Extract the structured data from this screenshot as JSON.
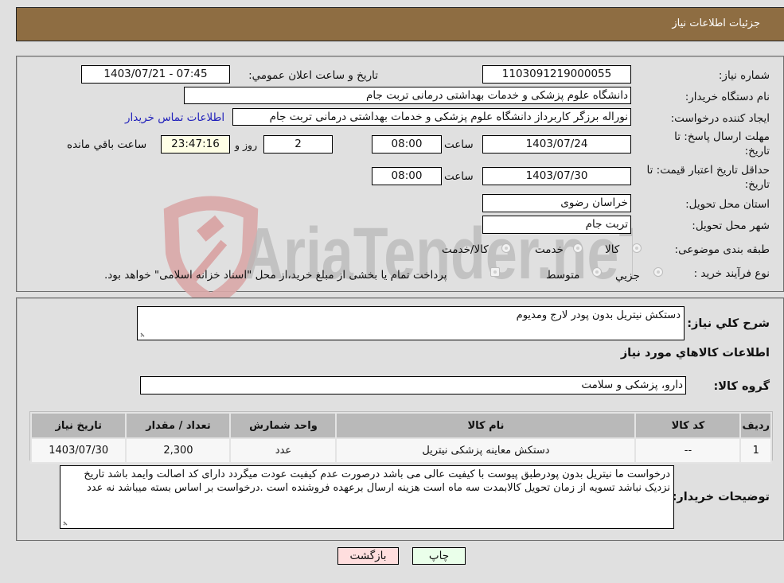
{
  "header": {
    "title": "جزئیات اطلاعات نیاز"
  },
  "form": {
    "need_number_label": "شماره نیاز:",
    "need_number": "1103091219000055",
    "announce_label": "تاریخ و ساعت اعلان عمومي:",
    "announce_value": "1403/07/21 - 07:45",
    "buyer_org_label": "نام دستگاه خریدار:",
    "buyer_org": "دانشگاه علوم پزشکی و خدمات بهداشتی  درمانی تربت جام",
    "creator_label": "ایجاد کننده درخواست:",
    "creator": "نوراله برزگر کاربرداز دانشگاه علوم پزشکی و خدمات بهداشتی  درمانی تربت جام",
    "contact_link": "اطلاعات تماس خریدار",
    "reply_deadline_label_1": "مهلت ارسال پاسخ: تا",
    "reply_deadline_label_2": "تاریخ:",
    "reply_date": "1403/07/24",
    "time_label": "ساعت",
    "reply_time": "08:00",
    "days_value": "2",
    "days_label": "روز و",
    "remaining_time": "23:47:16",
    "remaining_label": "ساعت باقي مانده",
    "price_validity_label_1": "حداقل تاریخ اعتبار قیمت: تا",
    "price_validity_label_2": "تاریخ:",
    "price_validity_date": "1403/07/30",
    "price_validity_time": "08:00",
    "province_label": "استان محل تحویل:",
    "province": "خراسان رضوی",
    "city_label": "شهر محل تحویل:",
    "city": "تربت جام",
    "category_label": "طبقه بندی موضوعی:",
    "category_options": [
      "کالا",
      "خدمت",
      "کالا/خدمت"
    ],
    "process_label": "نوع فرآیند خرید :",
    "process_options": [
      "جزیي",
      "متوسط"
    ],
    "payment_note": "پرداخت تمام یا بخشی از مبلغ خرید،از محل \"اسناد خزانه اسلامی\" خواهد بود."
  },
  "details": {
    "summary_label": "شرح کلي نیاز:",
    "summary": "دستکش نیتریل بدون پودر لارج ومدیوم",
    "items_heading": "اطلاعات کالاهاي مورد نیاز",
    "group_label": "گروه کالا:",
    "group": "دارو، پزشکی و سلامت",
    "table": {
      "headers": [
        "ردیف",
        "کد کالا",
        "نام کالا",
        "واحد شمارش",
        "تعداد / مقدار",
        "تاریخ نیاز"
      ],
      "rows": [
        [
          "1",
          "--",
          "دستکش معاینه پزشکی نیتریل",
          "عدد",
          "2,300",
          "1403/07/30"
        ]
      ]
    },
    "buyer_notes_label": "توضیحات خریدار:",
    "buyer_notes": "درخواست ما نیتریل بدون پودرطبق پیوست با کیفیت عالی می باشد درصورت عدم کیفیت عودت میگردد دارای کد اصالت وایمد باشد تاریخ نزدیک نباشد تسویه از زمان تحویل کالابمدت سه ماه است هزینه ارسال برعهده فروشنده است .درخواست بر اساس بسته میباشد نه عدد"
  },
  "buttons": {
    "print": "چاپ",
    "back": "بازگشت"
  },
  "watermark": {
    "text": "AriaTender.neT"
  },
  "colors": {
    "header_bg": "#8e6d42",
    "back_btn_bg": "#ffdede",
    "print_btn_bg": "#eaffea",
    "link": "#2222bb"
  }
}
